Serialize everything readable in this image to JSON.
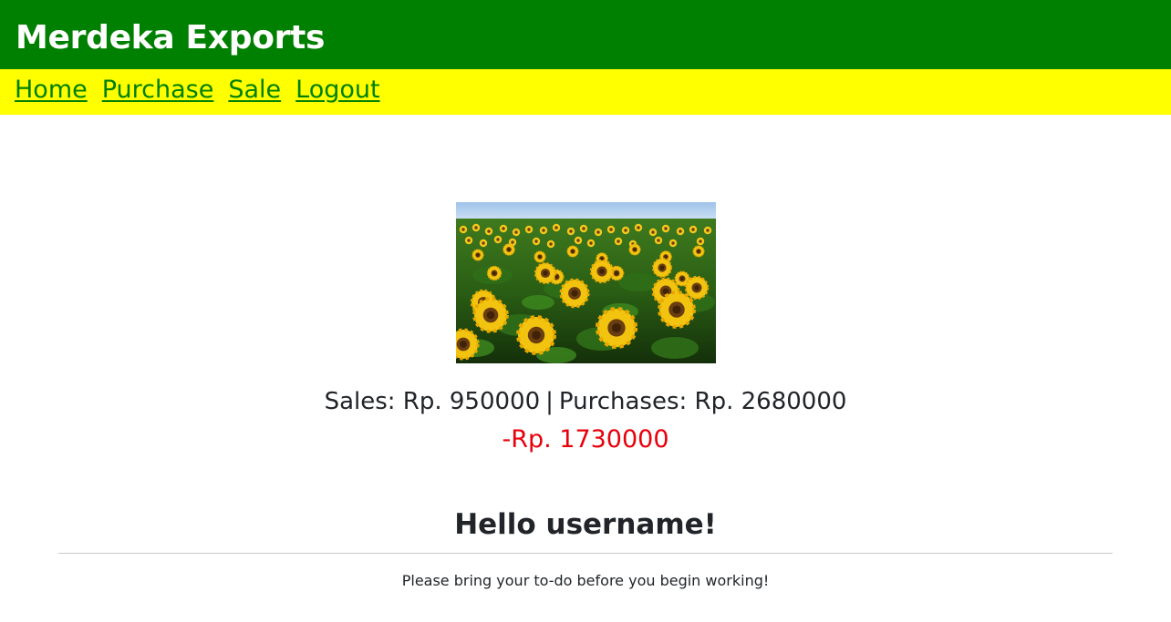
{
  "header": {
    "brand": "Merdeka Exports",
    "bg_color": "#008000",
    "text_color": "#ffffff"
  },
  "nav": {
    "bg_color": "#ffff00",
    "link_color": "#008000",
    "items": [
      {
        "label": "Home"
      },
      {
        "label": "Purchase"
      },
      {
        "label": "Sale"
      },
      {
        "label": "Logout"
      }
    ]
  },
  "main": {
    "image": "sunflower-field",
    "stats": {
      "sales_label": "Sales: Rp. 950000",
      "separator": "|",
      "purchases_label": "Purchases: Rp. 2680000"
    },
    "net_value": "-Rp. 1730000",
    "net_color": "#e8000b",
    "greeting": "Hello username!",
    "notice": "Please bring your to-do before you begin working!"
  }
}
